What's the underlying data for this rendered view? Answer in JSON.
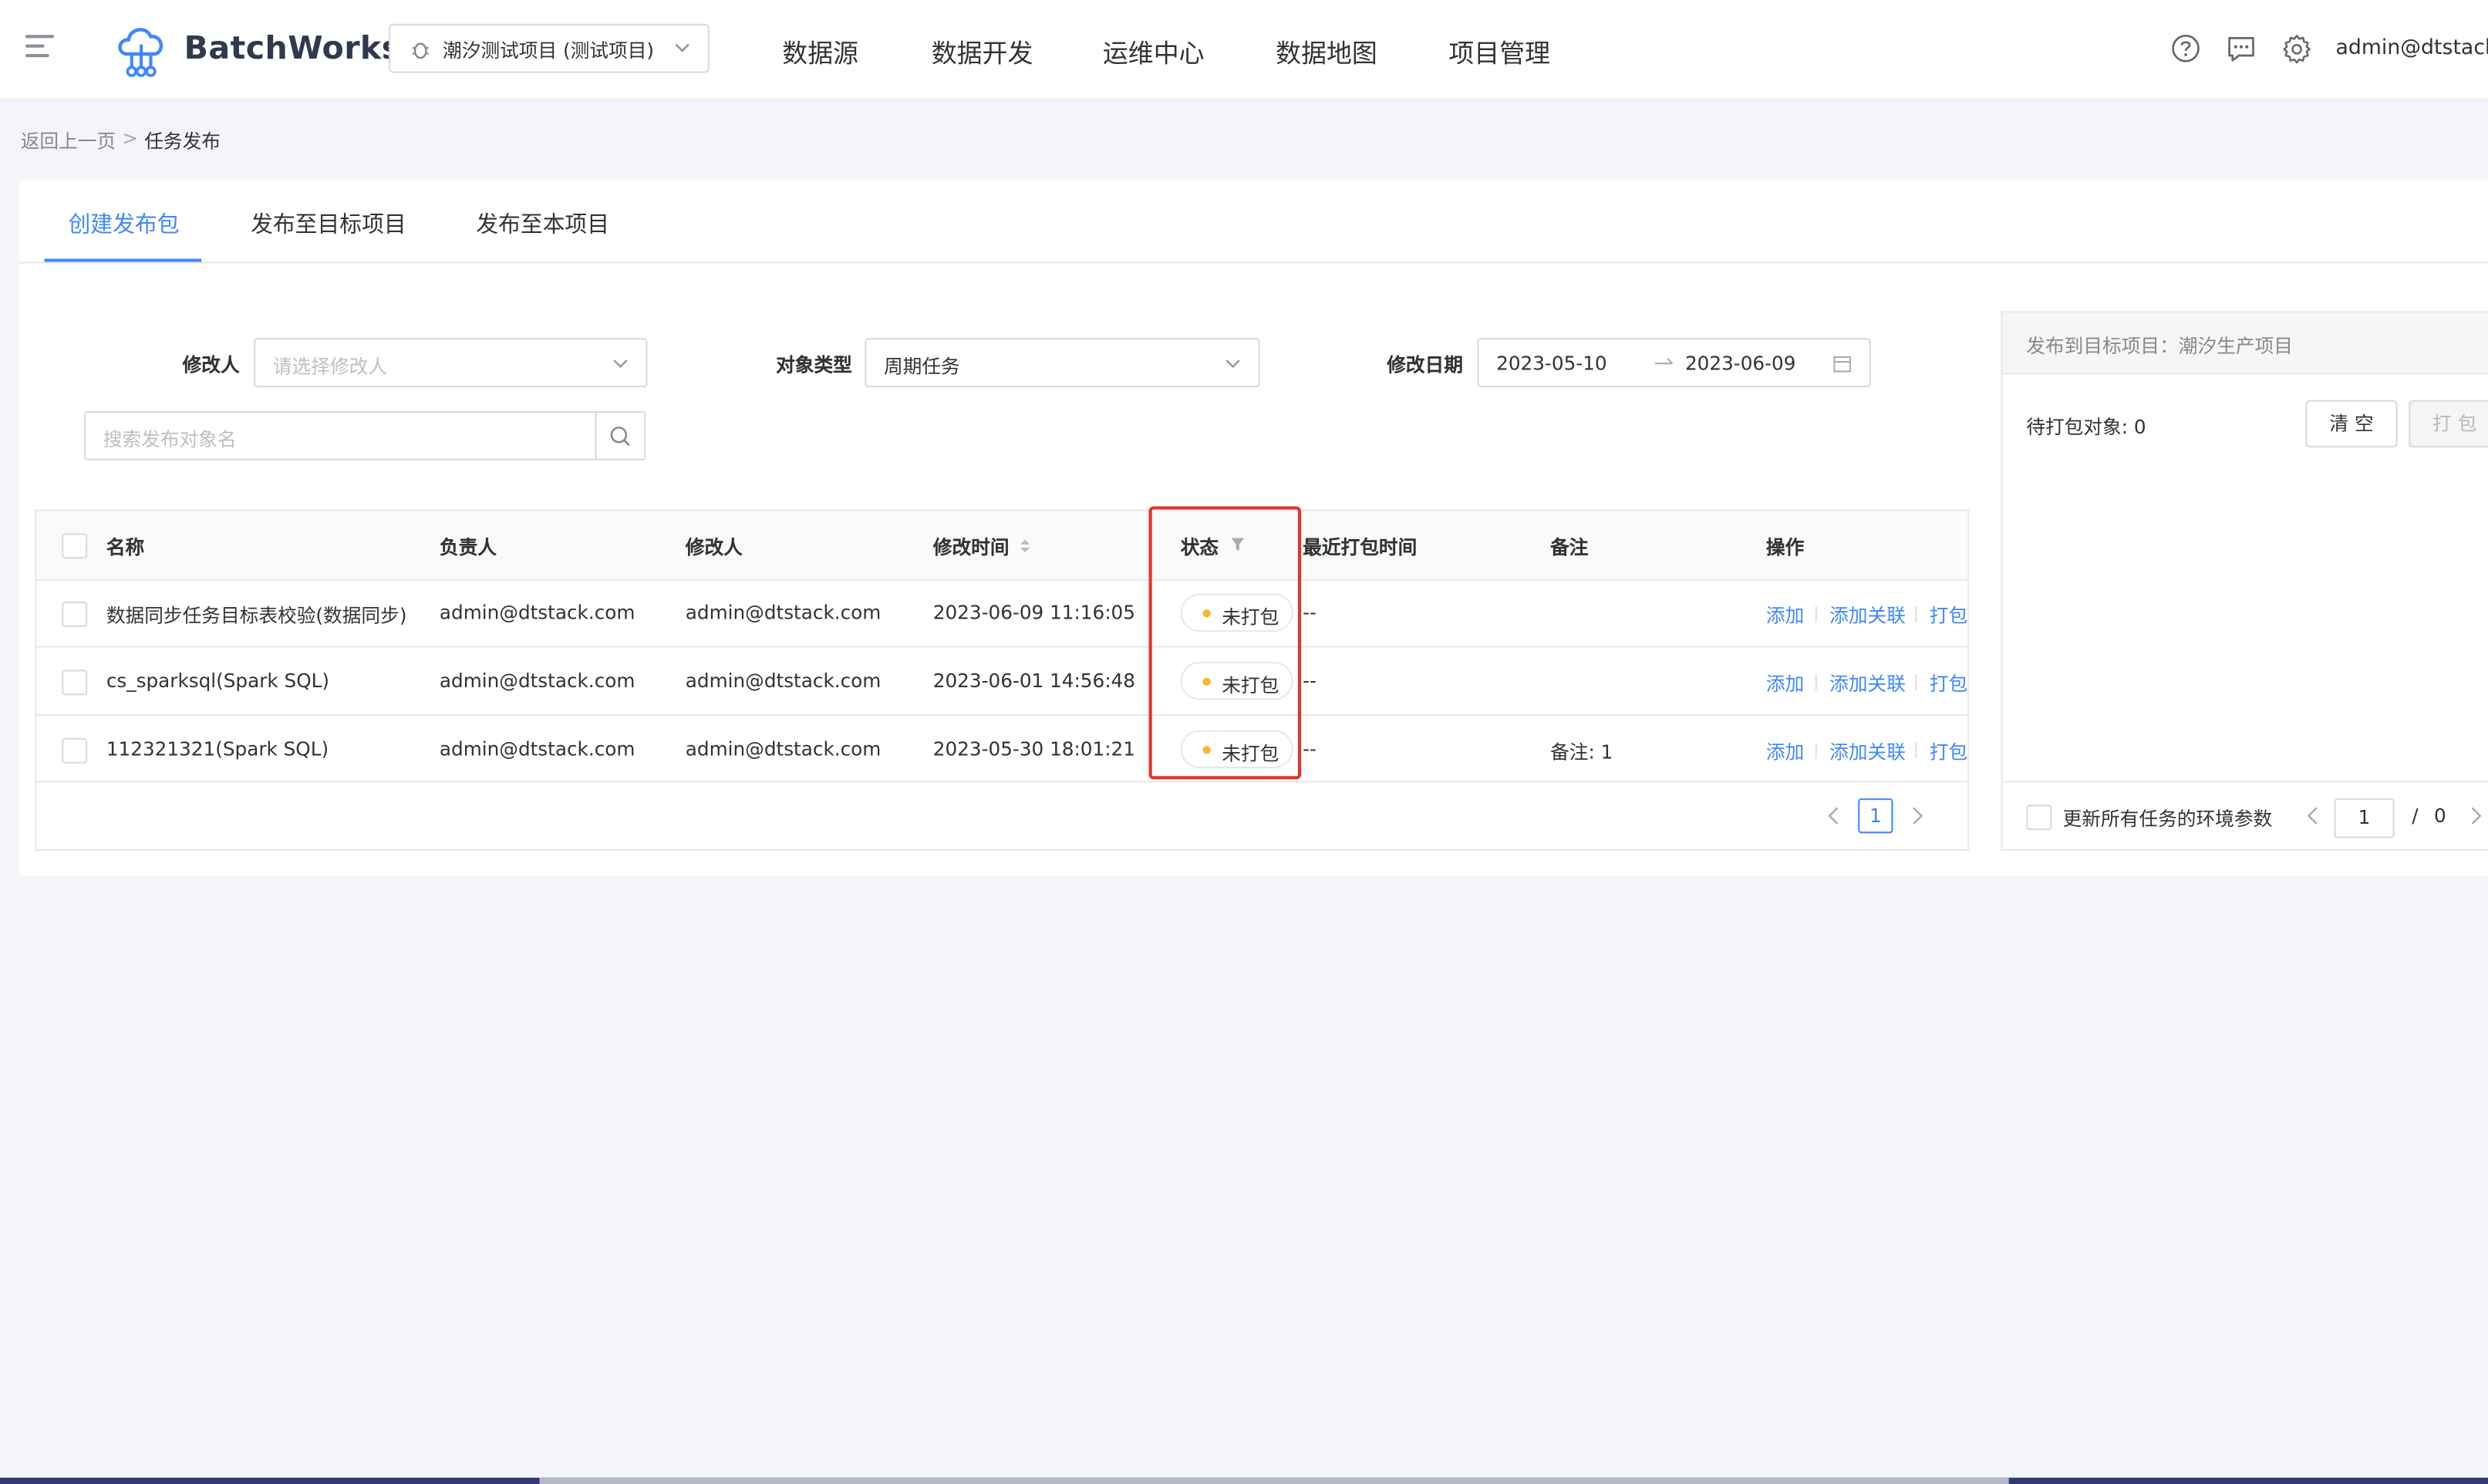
{
  "header": {
    "app_name": "BatchWorks",
    "project": "潮汐测试项目 (测试项目)",
    "nav": [
      "数据源",
      "数据开发",
      "运维中心",
      "数据地图",
      "项目管理"
    ],
    "user": "admin@dtstack.c"
  },
  "breadcrumb": {
    "back": "返回上一页",
    "separator": ">",
    "current": "任务发布"
  },
  "tabs": [
    {
      "label": "创建发布包",
      "active": true
    },
    {
      "label": "发布至目标项目",
      "active": false
    },
    {
      "label": "发布至本项目",
      "active": false
    }
  ],
  "filters": {
    "modifier_label": "修改人",
    "modifier_placeholder": "请选择修改人",
    "type_label": "对象类型",
    "type_value": "周期任务",
    "date_label": "修改日期",
    "date_start": "2023-05-10",
    "date_end": "2023-06-09",
    "search_placeholder": "搜索发布对象名"
  },
  "table": {
    "columns": [
      "名称",
      "负责人",
      "修改人",
      "修改时间",
      "状态",
      "最近打包时间",
      "备注",
      "操作"
    ],
    "rows": [
      {
        "name": "数据同步任务目标表校验(数据同步)",
        "owner": "admin@dtstack.com",
        "modifier": "admin@dtstack.com",
        "modified": "2023-06-09 11:16:05",
        "status": "未打包",
        "last_pack": "--",
        "note": ""
      },
      {
        "name": "cs_sparksql(Spark SQL)",
        "owner": "admin@dtstack.com",
        "modifier": "admin@dtstack.com",
        "modified": "2023-06-01 14:56:48",
        "status": "未打包",
        "last_pack": "--",
        "note": ""
      },
      {
        "name": "112321321(Spark SQL)",
        "owner": "admin@dtstack.com",
        "modifier": "admin@dtstack.com",
        "modified": "2023-05-30 18:01:21",
        "status": "未打包",
        "last_pack": "--",
        "note": "备注: 1"
      }
    ],
    "actions": [
      "添加",
      "添加关联",
      "打包"
    ],
    "page": "1"
  },
  "panel": {
    "title": "发布到目标项目：潮汐生产项目",
    "pending": "待打包对象: 0",
    "clear": "清 空",
    "pack": "打 包",
    "update_env": "更新所有任务的环境参数",
    "page": "1",
    "page_sep": "/",
    "page_total": "0"
  },
  "colors": {
    "accent": "#3f87ff",
    "status_dot": "#fab52a",
    "highlight": "#e0342b"
  }
}
